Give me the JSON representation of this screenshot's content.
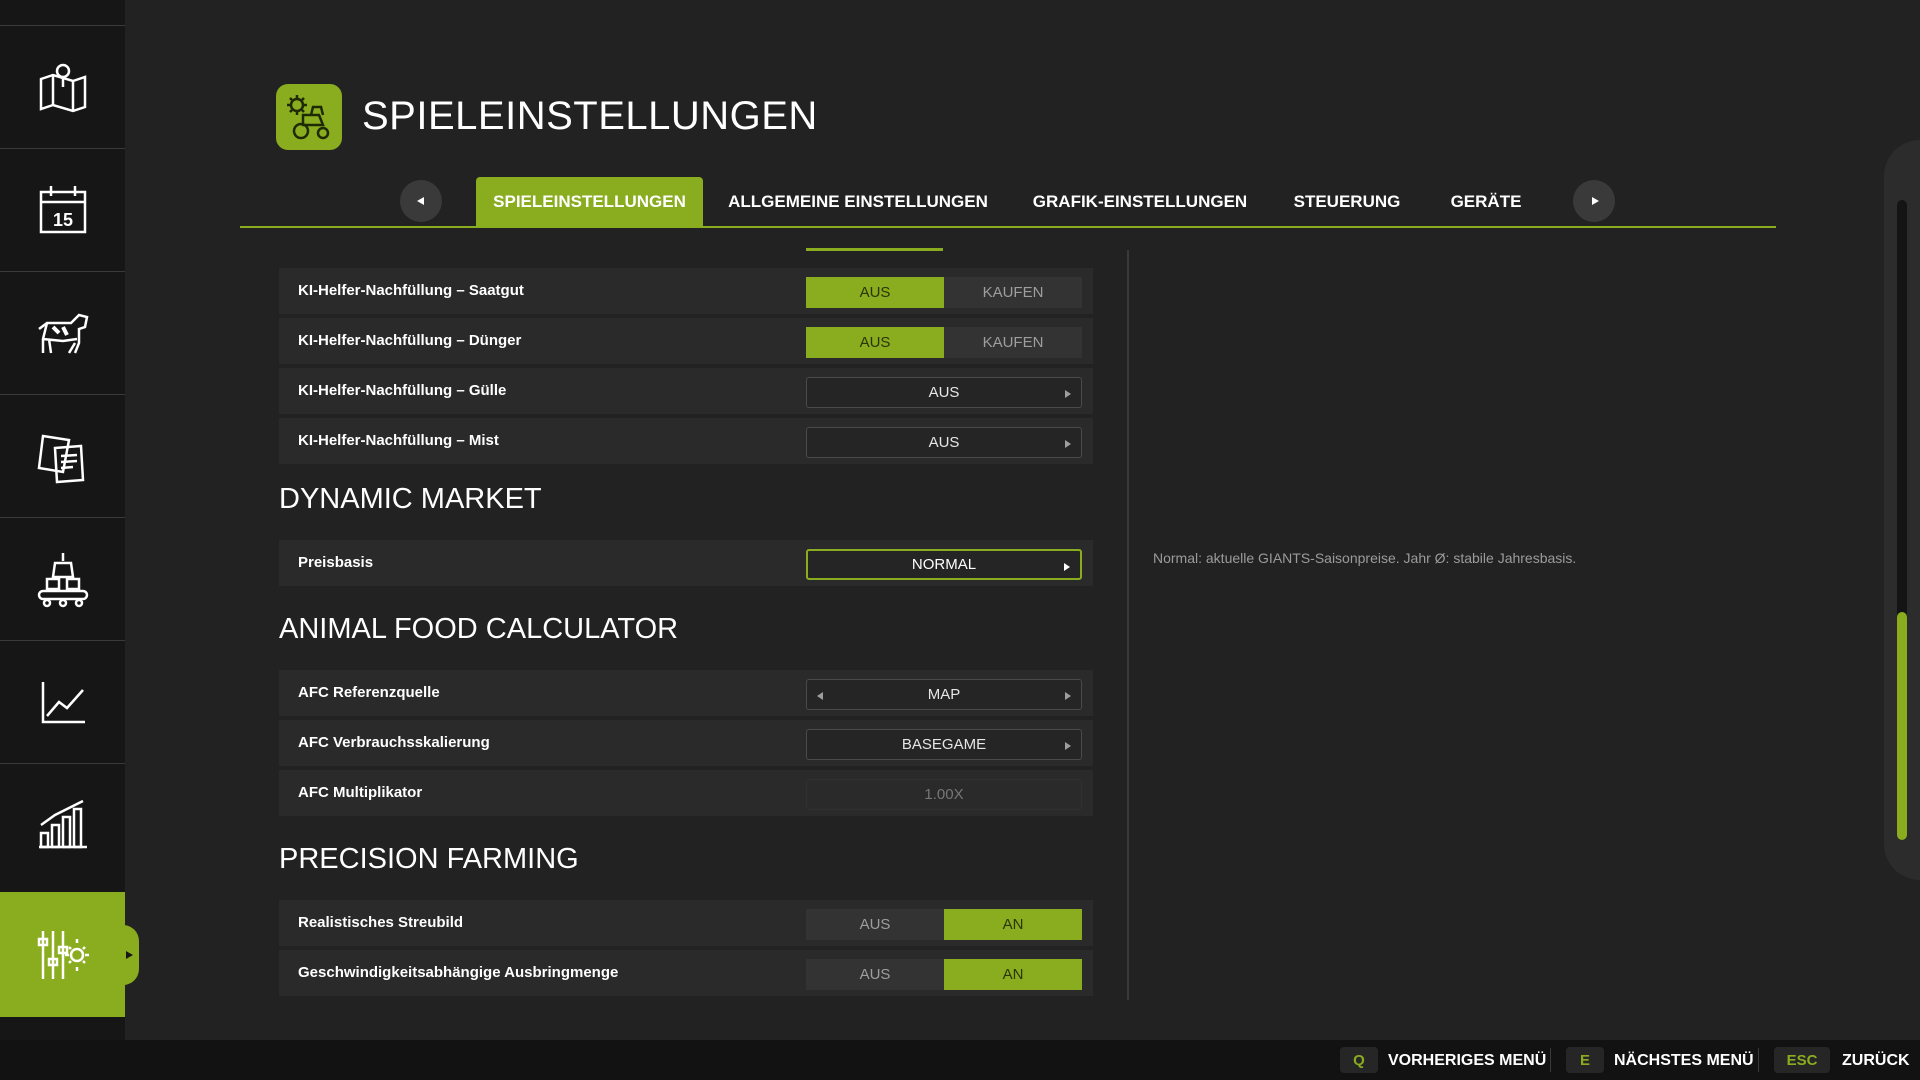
{
  "header": {
    "title": "SPIELEINSTELLUNGEN",
    "icon": "tractor-gear-icon"
  },
  "sidebar": {
    "items": [
      {
        "icon": "map-icon"
      },
      {
        "icon": "calendar-icon",
        "day": "15"
      },
      {
        "icon": "animals-icon"
      },
      {
        "icon": "contracts-icon"
      },
      {
        "icon": "production-icon"
      },
      {
        "icon": "prices-chart-icon"
      },
      {
        "icon": "statistics-icon"
      },
      {
        "icon": "settings-icon",
        "active": true
      }
    ]
  },
  "tabs": [
    {
      "label": "SPIELEINSTELLUNGEN",
      "active": true
    },
    {
      "label": "ALLGEMEINE EINSTELLUNGEN"
    },
    {
      "label": "GRAFIK-EINSTELLUNGEN"
    },
    {
      "label": "STEUERUNG"
    },
    {
      "label": "GERÄTE"
    }
  ],
  "settings": {
    "ki_saatgut": {
      "label": "KI-Helfer-Nachfüllung – Saatgut",
      "options": [
        "AUS",
        "KAUFEN"
      ],
      "selected": "AUS"
    },
    "ki_duenger": {
      "label": "KI-Helfer-Nachfüllung – Dünger",
      "options": [
        "AUS",
        "KAUFEN"
      ],
      "selected": "AUS"
    },
    "ki_guelle": {
      "label": "KI-Helfer-Nachfüllung – Gülle",
      "value": "AUS"
    },
    "ki_mist": {
      "label": "KI-Helfer-Nachfüllung – Mist",
      "value": "AUS"
    },
    "dynamic_market": {
      "title": "DYNAMIC MARKET",
      "preisbasis": {
        "label": "Preisbasis",
        "value": "NORMAL"
      }
    },
    "afc": {
      "title": "ANIMAL FOOD CALCULATOR",
      "referenzquelle": {
        "label": "AFC Referenzquelle",
        "value": "MAP"
      },
      "verbrauchsskalierung": {
        "label": "AFC Verbrauchsskalierung",
        "value": "BASEGAME"
      },
      "multiplikator": {
        "label": "AFC Multiplikator",
        "value": "1.00X"
      }
    },
    "precision": {
      "title": "PRECISION FARMING",
      "streubild": {
        "label": "Realistisches Streubild",
        "options": [
          "AUS",
          "AN"
        ],
        "selected": "AN"
      },
      "ausbringmenge": {
        "label": "Geschwindigkeitsabhängige Ausbringmenge",
        "options": [
          "AUS",
          "AN"
        ],
        "selected": "AN"
      }
    }
  },
  "help_text": "Normal: aktuelle GIANTS-Saisonpreise. Jahr Ø: stabile Jahresbasis.",
  "footer": [
    {
      "key": "Q",
      "label": "VORHERIGES MENÜ"
    },
    {
      "key": "E",
      "label": "NÄCHSTES MENÜ"
    },
    {
      "key": "ESC",
      "label": "ZURÜCK"
    }
  ],
  "colors": {
    "accent": "#8aac1f",
    "background": "#222222",
    "sidebar": "#161616",
    "row": "#2a2a2a"
  }
}
